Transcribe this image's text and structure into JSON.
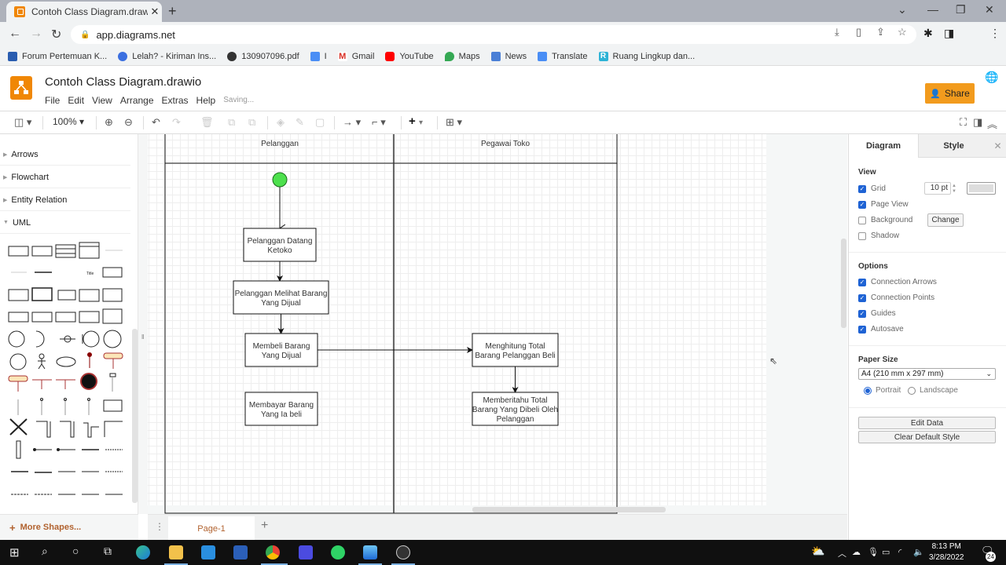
{
  "browser": {
    "tab_title": "Contoh Class Diagram.drawio - d",
    "url": "app.diagrams.net",
    "bookmarks": [
      {
        "label": "Forum Pertemuan K...",
        "color": "#2a5db0"
      },
      {
        "label": "Lelah? - Kiriman Ins...",
        "color": "#3b6fe0"
      },
      {
        "label": "130907096.pdf",
        "color": "#333333"
      },
      {
        "label": "I",
        "color": "#4a8ef5"
      },
      {
        "label": "Gmail",
        "color": "#d93025"
      },
      {
        "label": "YouTube",
        "color": "#ff0000"
      },
      {
        "label": "Maps",
        "color": "#34a853"
      },
      {
        "label": "News",
        "color": "#4a7fd6"
      },
      {
        "label": "Translate",
        "color": "#4a8ef5"
      },
      {
        "label": "Ruang Lingkup dan...",
        "color": "#2eb3d6"
      }
    ]
  },
  "app": {
    "title": "Contoh Class Diagram.drawio",
    "menu": [
      "File",
      "Edit",
      "View",
      "Arrange",
      "Extras",
      "Help"
    ],
    "status": "Saving...",
    "share_label": "Share",
    "accent": "#f08705"
  },
  "toolbar": {
    "zoom": "100%"
  },
  "sidebar": {
    "categories": [
      {
        "label": "Arrows",
        "expanded": false
      },
      {
        "label": "Flowchart",
        "expanded": false
      },
      {
        "label": "Entity Relation",
        "expanded": false
      },
      {
        "label": "UML",
        "expanded": true
      }
    ],
    "more_shapes": "More Shapes..."
  },
  "diagram": {
    "lanes": [
      {
        "label": "Pelanggan"
      },
      {
        "label": "Pegawai Toko"
      }
    ],
    "start_node_color": "#4de04d",
    "activities": [
      {
        "id": "a1",
        "label": [
          "Pelanggan Datang",
          "Ketoko"
        ]
      },
      {
        "id": "a2",
        "label": [
          "Pelanggan Melihat Barang",
          "Yang Dijual"
        ]
      },
      {
        "id": "a3",
        "label": [
          "Membeli Barang",
          "Yang Dijual"
        ]
      },
      {
        "id": "a4",
        "label": [
          "Membayar Barang",
          "Yang Ia beli"
        ]
      },
      {
        "id": "a5",
        "label": [
          "Menghitung Total",
          "Barang Pelanggan Beli"
        ]
      },
      {
        "id": "a6",
        "label": [
          "Memberitahu Total",
          "Barang Yang Dibeli Oleh",
          "Pelanggan"
        ]
      }
    ],
    "edges": [
      [
        "start",
        "a1"
      ],
      [
        "a1",
        "a2"
      ],
      [
        "a2",
        "a3"
      ],
      [
        "a3",
        "a5"
      ],
      [
        "a5",
        "a6"
      ]
    ]
  },
  "pages": {
    "tabs": [
      "Page-1"
    ]
  },
  "format_panel": {
    "tabs": [
      "Diagram",
      "Style"
    ],
    "view": {
      "heading": "View",
      "grid": {
        "label": "Grid",
        "checked": true,
        "size": "10 pt"
      },
      "page_view": {
        "label": "Page View",
        "checked": true
      },
      "background": {
        "label": "Background",
        "checked": false,
        "button": "Change"
      },
      "shadow": {
        "label": "Shadow",
        "checked": false
      }
    },
    "options": {
      "heading": "Options",
      "items": [
        {
          "label": "Connection Arrows",
          "checked": true
        },
        {
          "label": "Connection Points",
          "checked": true
        },
        {
          "label": "Guides",
          "checked": true
        },
        {
          "label": "Autosave",
          "checked": true
        }
      ]
    },
    "paper": {
      "heading": "Paper Size",
      "size": "A4 (210 mm x 297 mm)",
      "orientation": [
        {
          "label": "Portrait",
          "selected": true
        },
        {
          "label": "Landscape",
          "selected": false
        }
      ]
    },
    "buttons": [
      "Edit Data",
      "Clear Default Style"
    ]
  },
  "taskbar": {
    "time": "8:13 PM",
    "date": "3/28/2022",
    "notifications": "24"
  }
}
